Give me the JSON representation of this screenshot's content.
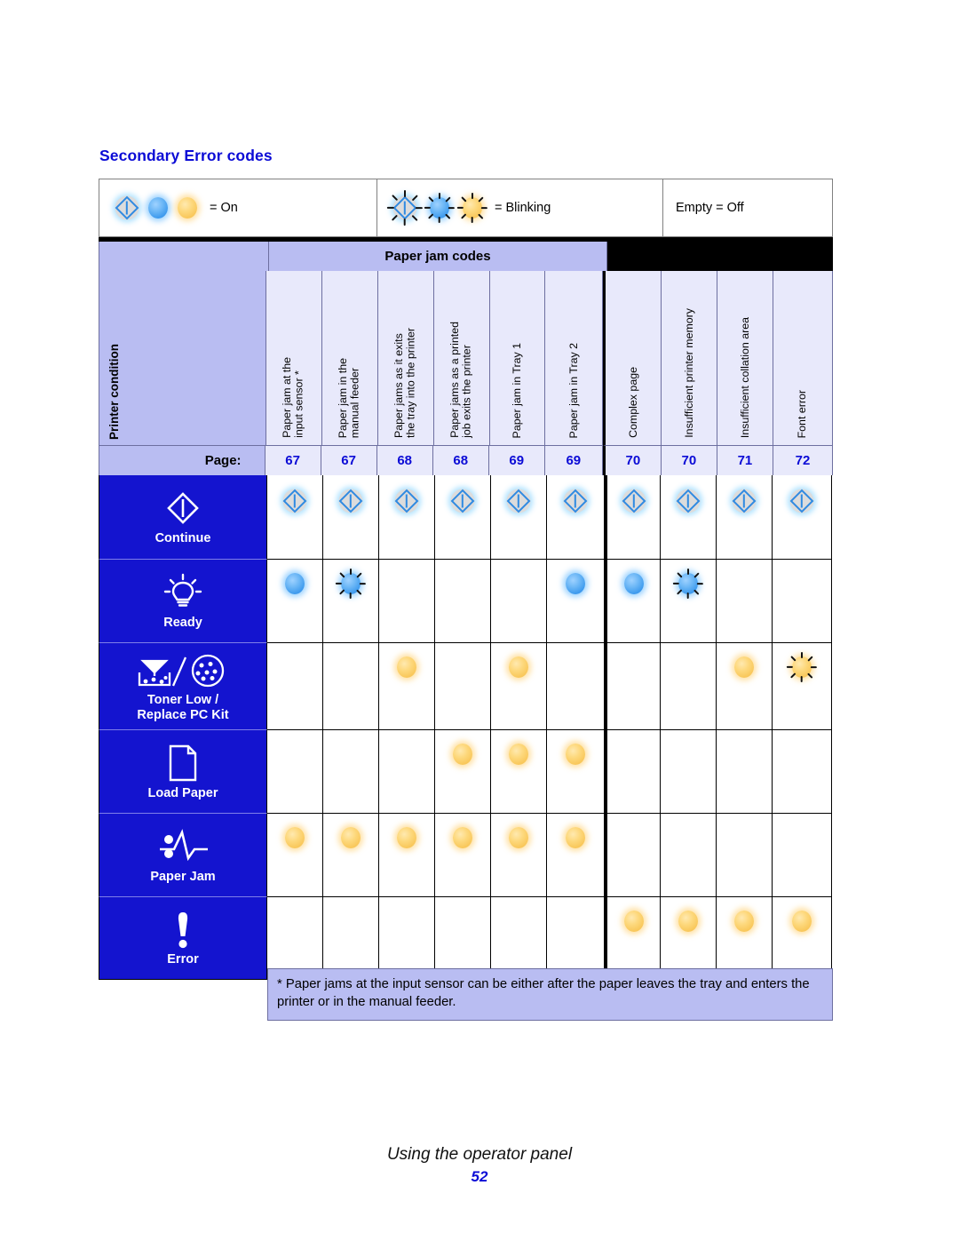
{
  "heading": "Secondary Error codes",
  "legend": {
    "on_label": "= On",
    "blinking_label": "= Blinking",
    "off_label": "Empty = Off"
  },
  "table": {
    "group_header": "Paper jam codes",
    "condition_header": "Printer condition",
    "page_label": "Page:",
    "columns": [
      {
        "title": "Paper jam at the\ninput sensor *",
        "page": "67",
        "group": "jam"
      },
      {
        "title": "Paper jam in the\nmanual feeder",
        "page": "67",
        "group": "jam"
      },
      {
        "title": "Paper jams as it exits\nthe tray into the printer",
        "page": "68",
        "group": "jam"
      },
      {
        "title": "Paper jams as a printed\njob exits the printer",
        "page": "68",
        "group": "jam"
      },
      {
        "title": "Paper jam in Tray 1",
        "page": "69",
        "group": "jam"
      },
      {
        "title": "Paper jam in Tray 2",
        "page": "69",
        "group": "jam"
      },
      {
        "title": "Complex page",
        "page": "70",
        "group": "other"
      },
      {
        "title": "Insufficient printer memory",
        "page": "70",
        "group": "other"
      },
      {
        "title": "Insufficient collation area",
        "page": "71",
        "group": "other"
      },
      {
        "title": "Font error",
        "page": "72",
        "group": "other"
      }
    ],
    "rows": [
      {
        "label": "Continue",
        "icon": "continue-diamond-icon",
        "states": [
          "on-blue-diamond",
          "on-blue-diamond",
          "on-blue-diamond",
          "on-blue-diamond",
          "on-blue-diamond",
          "on-blue-diamond",
          "on-blue-diamond",
          "on-blue-diamond",
          "on-blue-diamond",
          "on-blue-diamond"
        ]
      },
      {
        "label": "Ready",
        "icon": "ready-lightbulb-icon",
        "states": [
          "on-blue",
          "blinking-blue",
          "off",
          "off",
          "off",
          "on-blue",
          "on-blue",
          "blinking-blue",
          "off",
          "off"
        ]
      },
      {
        "label": "Toner Low /\nReplace PC Kit",
        "icon": "toner-low-pc-kit-icon",
        "states": [
          "off",
          "off",
          "on-amber",
          "off",
          "on-amber",
          "off",
          "off",
          "off",
          "on-amber",
          "blinking-amber"
        ]
      },
      {
        "label": "Load Paper",
        "icon": "load-paper-icon",
        "states": [
          "off",
          "off",
          "off",
          "on-amber",
          "on-amber",
          "on-amber",
          "off",
          "off",
          "off",
          "off"
        ]
      },
      {
        "label": "Paper Jam",
        "icon": "paper-jam-icon",
        "states": [
          "on-amber",
          "on-amber",
          "on-amber",
          "on-amber",
          "on-amber",
          "on-amber",
          "off",
          "off",
          "off",
          "off"
        ]
      },
      {
        "label": "Error",
        "icon": "error-exclamation-icon",
        "states": [
          "off",
          "off",
          "off",
          "off",
          "off",
          "off",
          "on-amber",
          "on-amber",
          "on-amber",
          "on-amber"
        ]
      }
    ]
  },
  "footnote": "* Paper jams at the input sensor can be either after the paper leaves the tray and enters the printer or in the manual feeder.",
  "footer": {
    "title": "Using the operator panel",
    "page_number": "52"
  },
  "colors": {
    "accent_blue": "#0b0bd6",
    "panel_blue": "#1414cf",
    "header_lavender": "#b9bdf2",
    "column_lavender": "#e8e9fb",
    "led_blue": "#3f9bee",
    "led_amber": "#f9c85c"
  }
}
